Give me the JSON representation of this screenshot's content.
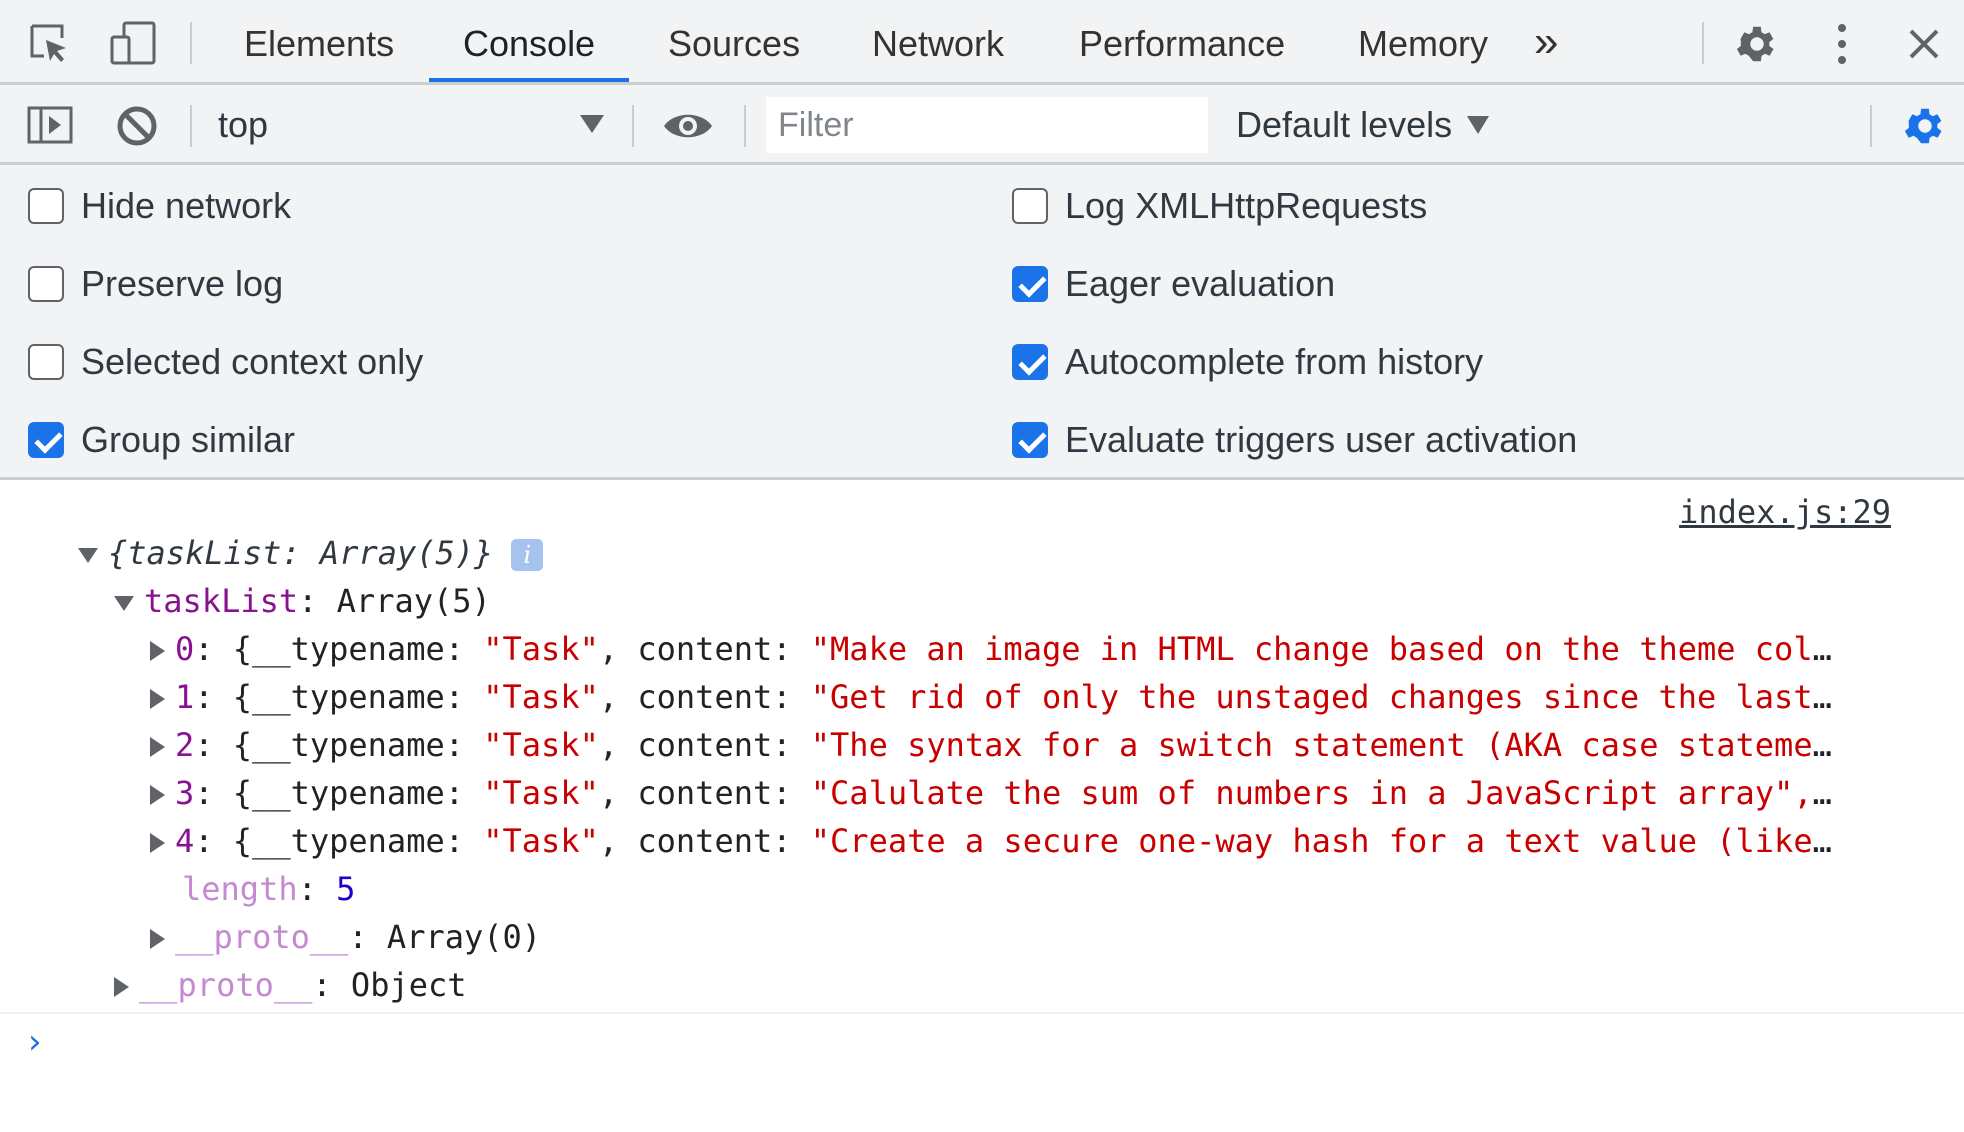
{
  "tabs": [
    {
      "label": "Elements"
    },
    {
      "label": "Console"
    },
    {
      "label": "Sources"
    },
    {
      "label": "Network"
    },
    {
      "label": "Performance"
    },
    {
      "label": "Memory"
    }
  ],
  "more_tabs_glyph": "»",
  "toolbar": {
    "context": "top",
    "filter_placeholder": "Filter",
    "levels": "Default levels"
  },
  "settings": {
    "left": [
      {
        "label": "Hide network",
        "checked": false
      },
      {
        "label": "Preserve log",
        "checked": false
      },
      {
        "label": "Selected context only",
        "checked": false
      },
      {
        "label": "Group similar",
        "checked": true
      }
    ],
    "right": [
      {
        "label": "Log XMLHttpRequests",
        "checked": false
      },
      {
        "label": "Eager evaluation",
        "checked": true
      },
      {
        "label": "Autocomplete from history",
        "checked": true
      },
      {
        "label": "Evaluate triggers user activation",
        "checked": true
      }
    ]
  },
  "log": {
    "source": "index.js:29",
    "summary": "{taskList: Array(5)}",
    "info_glyph": "i",
    "tasklist_key": "taskList",
    "tasklist_value": "Array(5)",
    "items": [
      {
        "index": "0",
        "typename": "\"Task\"",
        "content": "\"Make an image in HTML change based on the theme col"
      },
      {
        "index": "1",
        "typename": "\"Task\"",
        "content": "\"Get rid of only the unstaged changes since the last"
      },
      {
        "index": "2",
        "typename": "\"Task\"",
        "content": "\"The syntax for a switch statement (AKA case stateme"
      },
      {
        "index": "3",
        "typename": "\"Task\"",
        "content": "\"Calulate the sum of numbers in a JavaScript array\","
      },
      {
        "index": "4",
        "typename": "\"Task\"",
        "content": "\"Create a secure one-way hash for a text value (like"
      }
    ],
    "typename_key": "__typename",
    "content_key": "content",
    "ellipsis": "…",
    "length_key": "length",
    "length_value": "5",
    "proto_key": "__proto__",
    "array_proto_value": "Array(0)",
    "object_proto_value": "Object"
  },
  "prompt_glyph": "›",
  "colors": {
    "accent": "#1a73e8",
    "string": "#c80000",
    "key": "#881391",
    "number": "#1c00cf"
  }
}
